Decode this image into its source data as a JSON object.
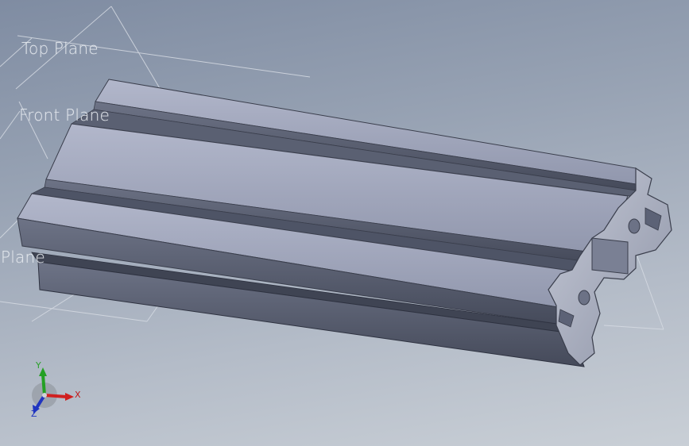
{
  "planes": {
    "top_label": "Top Plane",
    "front_label": "Front Plane",
    "right_label": "Plane"
  },
  "triad": {
    "x_label": "X",
    "y_label": "Y",
    "z_label": "Z",
    "x_color": "#d02020",
    "y_color": "#24a024",
    "z_color": "#2035c0"
  },
  "colors": {
    "background_top": "#7f8ca2",
    "background_bottom": "#c9cfd6",
    "part_light": "#a8aec4",
    "part_mid": "#8b91a6",
    "part_dark": "#4c5162",
    "plane_line": "#d6dbe3"
  }
}
